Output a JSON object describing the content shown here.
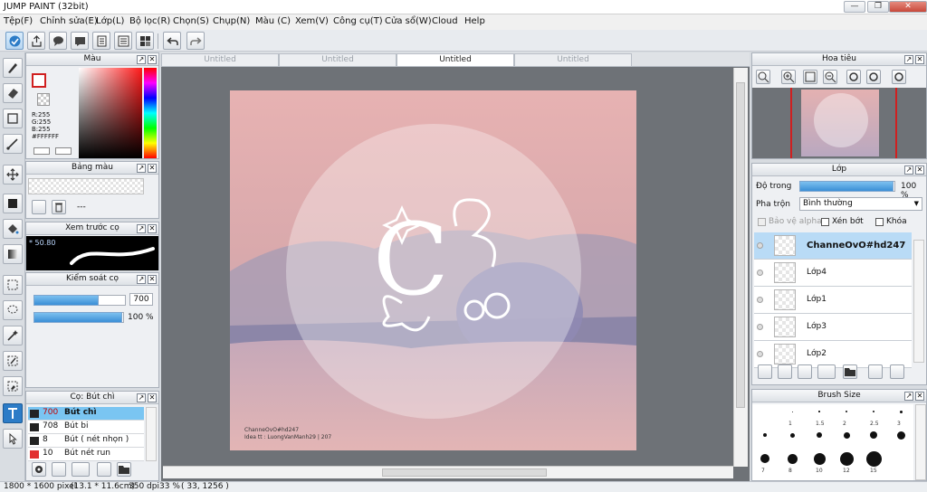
{
  "window": {
    "title": "JUMP PAINT (32bit)"
  },
  "menu": [
    "Tệp(F)",
    "Chỉnh sửa(E)",
    "Lớp(L)",
    "Bộ lọc(R)",
    "Chọn(S)",
    "Chụp(N)",
    "Màu (C)",
    "Xem(V)",
    "Công cụ(T)",
    "Cửa sổ(W)",
    "Cloud",
    "Help"
  ],
  "tabs": [
    "Untitled",
    "Untitled",
    "Untitled",
    "Untitled"
  ],
  "active_tab": 2,
  "color_panel": {
    "title": "Màu",
    "r": "R:255",
    "g": "G:255",
    "b": "B:255",
    "hex": "#FFFFFF"
  },
  "palette_panel": {
    "title": "Bảng màu",
    "value": "---"
  },
  "brush_preview": {
    "title": "Xem trước cọ",
    "size": "* 50.80"
  },
  "brush_control": {
    "title": "Kiểm soát cọ",
    "size": "700",
    "opacity": "100 %",
    "size_fraction": 0.72,
    "opacity_fraction": 1.0
  },
  "brush_list": {
    "title": "Cọ: Bút chì",
    "items": [
      {
        "size": "700",
        "name": "Bút chì",
        "color": "#222222",
        "selected": true
      },
      {
        "size": "708",
        "name": "Bút bi",
        "color": "#222222",
        "selected": false
      },
      {
        "size": "8",
        "name": "Bút ( nét nhọn )",
        "color": "#222222",
        "selected": false
      },
      {
        "size": "10",
        "name": "Bút nét run",
        "color": "#e23030",
        "selected": false
      }
    ]
  },
  "navigator": {
    "title": "Hoa tiêu"
  },
  "layers": {
    "title": "Lớp",
    "opacity_label": "Độ trong",
    "opacity_value": "100 %",
    "opacity_fraction": 1.0,
    "blend_label": "Pha trộn",
    "blend_value": "Bình thường",
    "protect_alpha": "Bảo vệ alpha",
    "clip": "Xén bớt",
    "lock": "Khóa",
    "items": [
      {
        "name": "ChanneOvO#hd247",
        "selected": true
      },
      {
        "name": "Lớp4",
        "selected": false
      },
      {
        "name": "Lớp1",
        "selected": false
      },
      {
        "name": "Lớp3",
        "selected": false
      },
      {
        "name": "Lớp2",
        "selected": false
      }
    ]
  },
  "brush_size": {
    "title": "Brush Size",
    "rows": [
      [
        "",
        "1",
        "1.5",
        "2",
        "2.5",
        "3"
      ],
      [
        "",
        "",
        "",
        "",
        "",
        ""
      ],
      [
        "7",
        "8",
        "10",
        "12",
        "15",
        ""
      ]
    ]
  },
  "artwork": {
    "caption_line1": "ChanneOvO#hd247",
    "caption_line2": "Idea tt : LuongVanManh29 | 207"
  },
  "status": {
    "pixels": "1800 * 1600 pixel",
    "cm": "(13.1 * 11.6cm)",
    "dpi": "350 dpi",
    "zoom": "33 %",
    "coords": "( 33, 1256 )"
  },
  "colors": {
    "accent": "#2c7cc7",
    "selection": "#7ac5f2",
    "canvas_bg": "#6e7277"
  }
}
